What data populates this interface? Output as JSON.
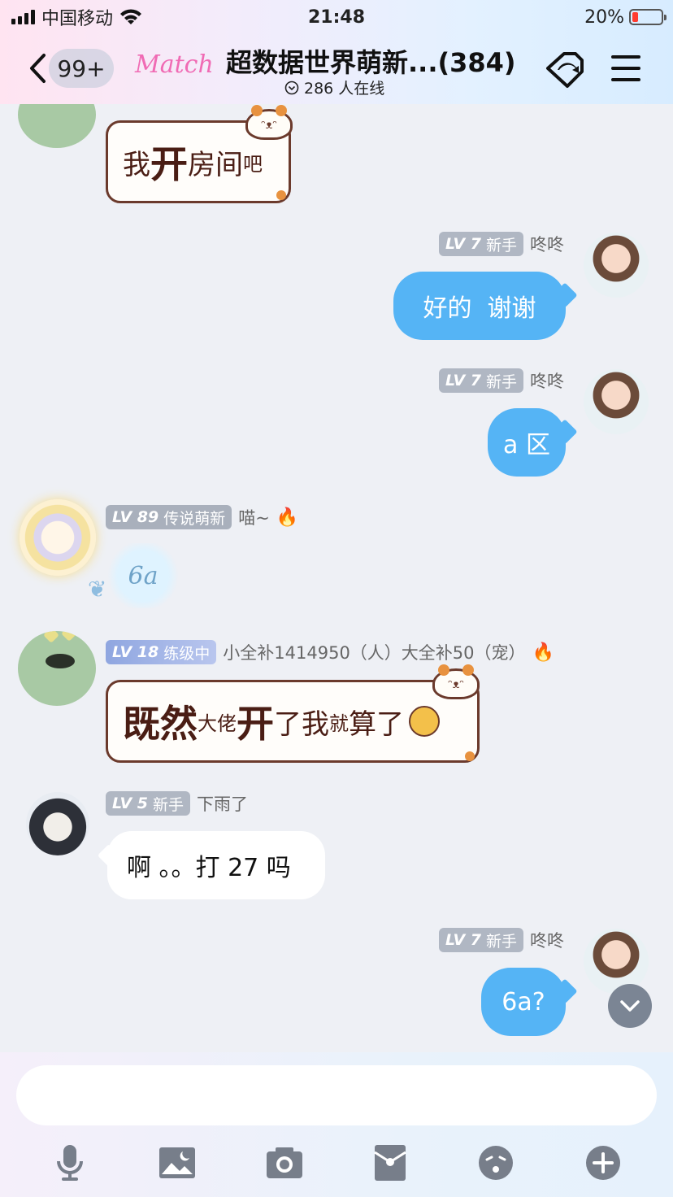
{
  "status_bar": {
    "carrier": "中国移动",
    "time": "21:48",
    "battery": "20%",
    "battery_level": 0.2,
    "battery_color": "#ff3b30"
  },
  "header": {
    "unread_count": "99+",
    "logo_text": "Match",
    "title": "超数据世界萌新...(384)",
    "online_text": "286 人在线"
  },
  "messages": [
    {
      "side": "left",
      "text_parts": [
        "我",
        "开",
        "房间",
        "吧"
      ]
    },
    {
      "side": "right",
      "level": "LV 7",
      "rank": "新手",
      "nick": "咚咚",
      "text": "好的  谢谢"
    },
    {
      "side": "right",
      "level": "LV 7",
      "rank": "新手",
      "nick": "咚咚",
      "text": "a 区"
    },
    {
      "side": "left",
      "level": "LV 89",
      "rank": "传说萌新",
      "nick": "喵~",
      "badge": "🔥",
      "sticker_text": "6a"
    },
    {
      "side": "left",
      "level": "LV 18",
      "rank": "练级中",
      "nick": "小全补1414950（人）大全补50（宠）",
      "badge": "🔥",
      "text_parts": [
        "既然",
        "大佬",
        "开",
        "了",
        "我",
        "就",
        "算",
        "了"
      ]
    },
    {
      "side": "left",
      "level": "LV 5",
      "rank": "新手",
      "nick": "下雨了",
      "text": "啊 。。打 27 吗"
    },
    {
      "side": "right",
      "level": "LV 7",
      "rank": "新手",
      "nick": "咚咚",
      "text": "6a?"
    }
  ],
  "input": {
    "placeholder": ""
  },
  "toolbar": [
    "mic-icon",
    "image-icon",
    "camera-icon",
    "red-packet-icon",
    "emoji-icon",
    "plus-icon"
  ],
  "colors": {
    "self_bubble": "#55b4f5",
    "accent_pink": "#f06bb4"
  }
}
